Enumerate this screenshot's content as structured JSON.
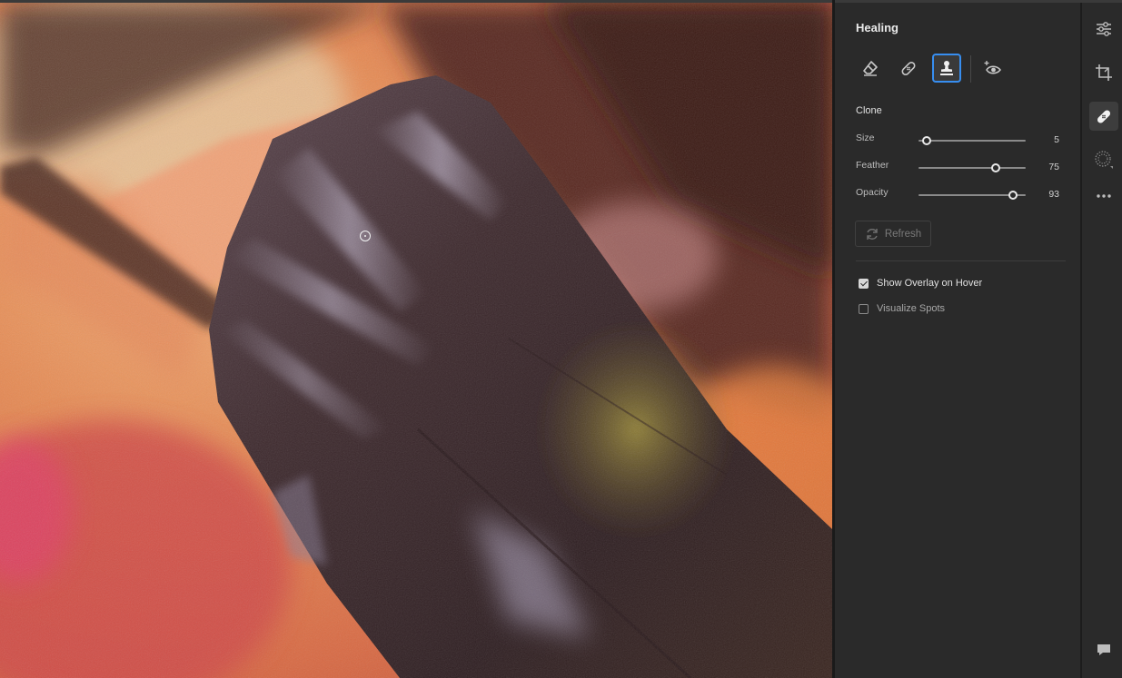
{
  "panel": {
    "title": "Healing",
    "tools": [
      {
        "name": "eraser-icon",
        "active": false
      },
      {
        "name": "heal-bandage-icon",
        "active": false
      },
      {
        "name": "clone-stamp-icon",
        "active": true
      },
      {
        "name": "red-eye-icon",
        "active": false
      }
    ],
    "section_label": "Clone",
    "sliders": [
      {
        "label": "Size",
        "value": "5",
        "fraction": 0.08
      },
      {
        "label": "Feather",
        "value": "75",
        "fraction": 0.72
      },
      {
        "label": "Opacity",
        "value": "93",
        "fraction": 0.88
      }
    ],
    "refresh_label": "Refresh",
    "checkboxes": [
      {
        "label": "Show Overlay on Hover",
        "checked": true
      },
      {
        "label": "Visualize Spots",
        "checked": false
      }
    ]
  },
  "rail": {
    "items": [
      {
        "name": "edit-sliders-icon",
        "active": false
      },
      {
        "name": "crop-icon",
        "active": false
      },
      {
        "name": "healing-icon",
        "active": true
      },
      {
        "name": "masking-icon",
        "active": false
      },
      {
        "name": "more-icon",
        "active": false
      }
    ],
    "bottom": {
      "name": "comments-icon"
    }
  },
  "colors": {
    "accent": "#378ef0",
    "panel_bg": "#2a2a2a"
  }
}
